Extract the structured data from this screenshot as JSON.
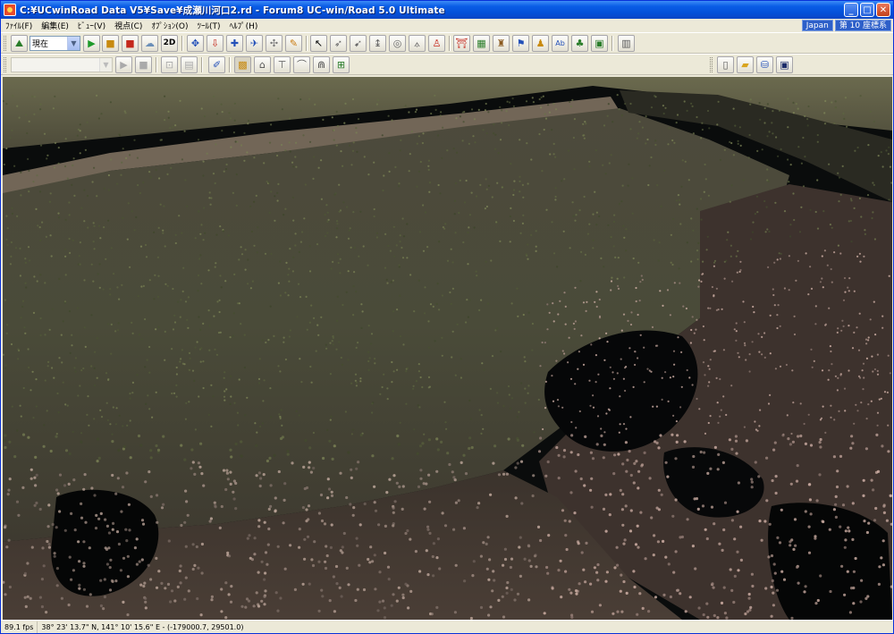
{
  "window": {
    "title": "C:¥UCwinRoad Data V5¥Save¥成瀬川河口2.rd - Forum8 UC-win/Road 5.0 Ultimate",
    "caption_buttons": {
      "minimize": "_",
      "maximize": "□",
      "close": "✕"
    }
  },
  "menu": {
    "items": [
      "ﾌｧｲﾙ(F)",
      "編集(E)",
      "ﾋﾞｭｰ(V)",
      "視点(C)",
      "ｵﾌﾟｼｮﾝ(O)",
      "ﾂｰﾙ(T)",
      "ﾍﾙﾌﾟ(H)"
    ],
    "region": "Japan",
    "coord_system": "第 10 座標系"
  },
  "toolbar1": {
    "time_combo_value": "現在",
    "view2d_label": "2D"
  },
  "toolbar2": {
    "scenario_combo_value": ""
  },
  "status": {
    "fps": "89.1 fps",
    "position": "38°  23' 13.7\" N, 141°  10' 15.6\" E  -  (-179000.7, 29501.0)"
  },
  "colors": {
    "title_bar": "#0a5de6",
    "chrome": "#ece9d8",
    "terrain_green": "#5a5f3a",
    "terrain_brown": "#5a4a3c",
    "points_pink": "#c9b0a8",
    "water_dark": "#06080a"
  }
}
